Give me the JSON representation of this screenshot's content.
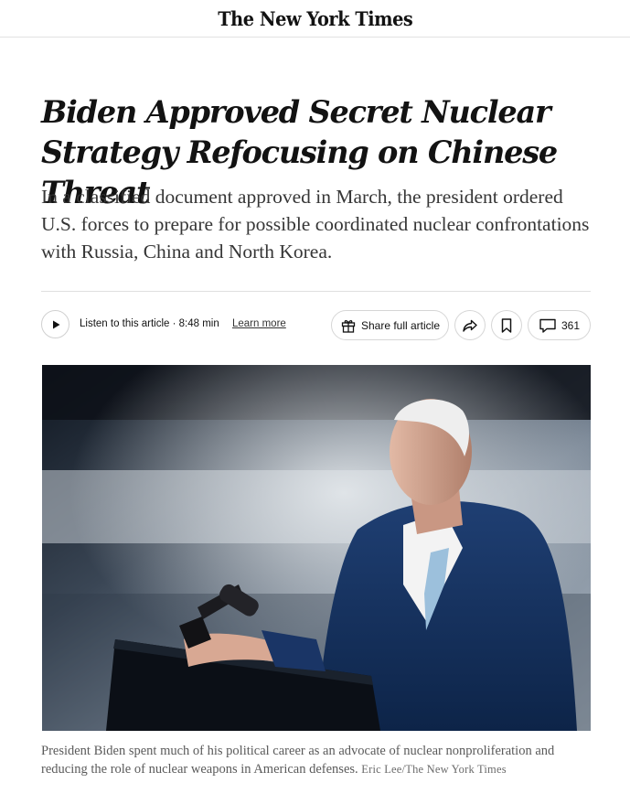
{
  "masthead": {
    "logo_text": "The New York Times"
  },
  "article": {
    "headline": "Biden Approved Secret Nuclear Strategy Refocusing on Chinese Threat",
    "summary": "In a classified document approved in March, the president ordered U.S. forces to prepare for possible coordinated nuclear confrontations with Russia, China and North Korea."
  },
  "toolbar": {
    "listen_label": "Listen to this article · 8:48 min",
    "learn_more": "Learn more",
    "share_full_label": "Share full article",
    "comment_count": "361",
    "icons": [
      "play-icon",
      "gift-icon",
      "share-arrow-icon",
      "bookmark-icon",
      "comment-icon"
    ]
  },
  "photo": {
    "caption": "President Biden spent much of his political career as an advocate of nuclear nonproliferation and reducing the role of nuclear weapons in American defenses.",
    "credit": "Eric Lee/The New York Times"
  },
  "colors": {
    "text": "#121212",
    "summary_text": "#363636",
    "caption_text": "#5a5a5a",
    "border": "#dfdfdf"
  }
}
